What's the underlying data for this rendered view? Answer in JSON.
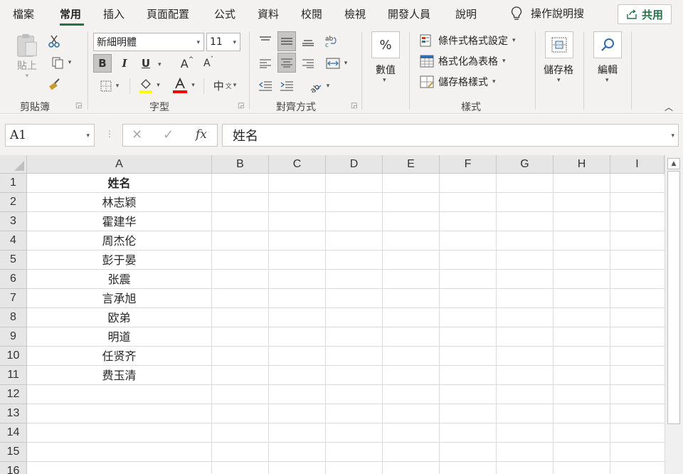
{
  "menu": {
    "tabs": [
      "檔案",
      "常用",
      "插入",
      "頁面配置",
      "公式",
      "資料",
      "校閱",
      "檢視",
      "開發人員",
      "說明"
    ],
    "active_tab": "常用",
    "tellme": "操作說明搜",
    "share": "共用",
    "accent": "#217346"
  },
  "ribbon": {
    "clipboard": {
      "label": "剪貼簿",
      "paste": "貼上"
    },
    "font": {
      "label": "字型",
      "font_name": "新細明體",
      "font_size": "11",
      "bold": "B",
      "italic": "I",
      "underline": "U",
      "grow": "A",
      "shrink": "A",
      "phonetic": "中",
      "fill_color": "#ffff00",
      "font_color": "#ff0000"
    },
    "alignment": {
      "label": "對齊方式"
    },
    "number": {
      "label": "數值",
      "symbol": "%"
    },
    "styles": {
      "label": "樣式",
      "conditional": "條件式格式設定",
      "as_table": "格式化為表格",
      "cell_styles": "儲存格樣式"
    },
    "cells": {
      "label": "儲存格"
    },
    "editing": {
      "label": "編輯"
    }
  },
  "formula_bar": {
    "name_box": "A1",
    "cancel": "✕",
    "enter": "✓",
    "fx": "fx",
    "value": "姓名"
  },
  "grid": {
    "columns": [
      "A",
      "B",
      "C",
      "D",
      "E",
      "F",
      "G",
      "H",
      "I"
    ],
    "rows": [
      "1",
      "2",
      "3",
      "4",
      "5",
      "6",
      "7",
      "8",
      "9",
      "10",
      "11",
      "12",
      "13",
      "14",
      "15",
      "16"
    ],
    "column_a": [
      "姓名",
      "林志颖",
      "霍建华",
      "周杰伦",
      "彭于晏",
      "张震",
      "言承旭",
      "欧弟",
      "明道",
      "任贤齐",
      "费玉清"
    ]
  }
}
